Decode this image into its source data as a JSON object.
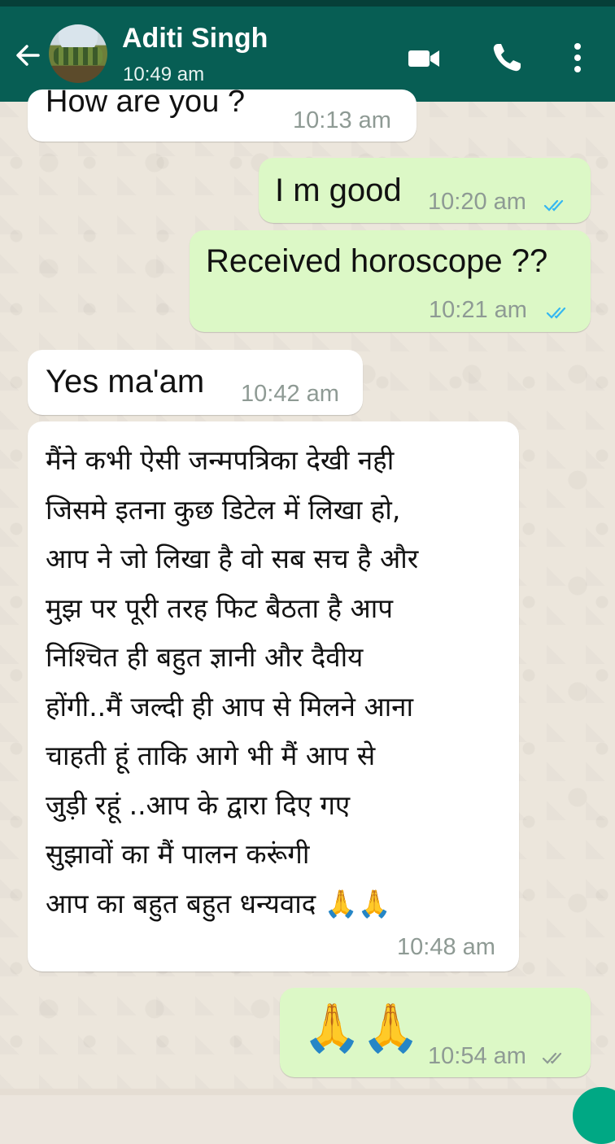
{
  "header": {
    "contact_name": "Aditi Singh",
    "last_seen": "10:49 am",
    "icons": [
      "back-arrow-icon",
      "avatar",
      "video-call-icon",
      "voice-call-icon",
      "more-menu-icon"
    ],
    "colors": {
      "header_bg": "#075e54",
      "outgoing_bubble": "#dcf8c6",
      "incoming_bubble": "#ffffff",
      "read_ticks": "#34b7f1"
    }
  },
  "messages": [
    {
      "direction": "incoming",
      "text": "How are you ?",
      "time": "10:13 am"
    },
    {
      "direction": "outgoing",
      "text": "I m good",
      "time": "10:20 am",
      "status": "read"
    },
    {
      "direction": "outgoing",
      "text": "Received horoscope ??",
      "time": "10:21 am",
      "status": "read"
    },
    {
      "direction": "incoming",
      "text": "Yes ma'am",
      "time": "10:42 am"
    },
    {
      "direction": "incoming",
      "text": "मैंने कभी ऐसी जन्मपत्रिका देखी नही\nजिसमे इतना कुछ डिटेल में लिखा हो,\nआप ने जो लिखा है वो सब सच है और\nमुझ पर पूरी तरह  फिट बैठता है आप\nनिश्चित ही बहुत ज्ञानी  और दैवीय\nहोंगी..मैं जल्दी ही आप से मिलने आना\nचाहती हूं ताकि आगे भी मैं आप से\nजुड़ी रहूं ..आप के द्वारा दिए गए\nसुझावों का मैं पालन करूंगी\nआप का बहुत बहुत धन्यवाद 🙏🙏",
      "time": "10:48 am"
    },
    {
      "direction": "outgoing",
      "text": "🙏🙏",
      "time": "10:54 am",
      "status": "sent"
    }
  ]
}
